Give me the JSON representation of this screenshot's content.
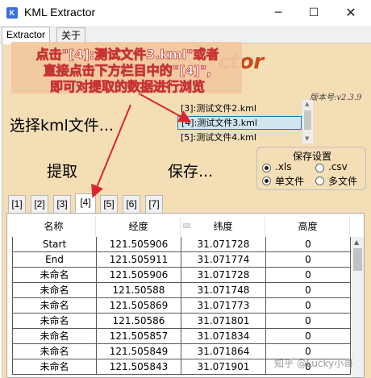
{
  "window": {
    "icon_letter": "K",
    "title": "KML Extractor",
    "min_glyph": "─",
    "max_glyph": "☐",
    "close_glyph": "✕"
  },
  "tabs": [
    {
      "label": "Extractor",
      "active": true
    },
    {
      "label": "关于",
      "active": false
    }
  ],
  "logo_fragment": "ctor",
  "version": "版本号:v2.3.9",
  "annotation": {
    "line1": "点击\"[4]:测试文件3.kml\"或者",
    "line2": "直接点击下方栏目中的\"[4]\",",
    "line3": "即可对提取的数据进行浏览"
  },
  "buttons": {
    "select_kml": "选择kml文件...",
    "extract": "提取",
    "save": "保存..."
  },
  "file_list": {
    "items": [
      {
        "label": "[3]:测试文件2.kml",
        "selected": false
      },
      {
        "label": "[4]:测试文件3.kml",
        "selected": true
      },
      {
        "label": "[5]:测试文件4.kml",
        "selected": false
      }
    ]
  },
  "save_settings": {
    "title": "保存设置",
    "formats": [
      {
        "label": ".xls",
        "checked": true
      },
      {
        "label": ".csv",
        "checked": false
      }
    ],
    "modes": [
      {
        "label": "单文件",
        "checked": true
      },
      {
        "label": "多文件",
        "checked": false
      }
    ]
  },
  "sub_tabs": [
    "[1]",
    "[2]",
    "[3]",
    "[4]",
    "[5]",
    "[6]",
    "[7]"
  ],
  "active_sub_tab": "[4]",
  "table": {
    "columns": [
      "名称",
      "经度",
      "纬度",
      "高度"
    ],
    "rows": [
      [
        "Start",
        "121.505906",
        "31.071728",
        "0"
      ],
      [
        "End",
        "121.505911",
        "31.071774",
        "0"
      ],
      [
        "未命名",
        "121.505906",
        "31.071728",
        "0"
      ],
      [
        "未命名",
        "121.50588",
        "31.071748",
        "0"
      ],
      [
        "未命名",
        "121.505869",
        "31.071773",
        "0"
      ],
      [
        "未命名",
        "121.50586",
        "31.071801",
        "0"
      ],
      [
        "未命名",
        "121.505857",
        "31.071834",
        "0"
      ],
      [
        "未命名",
        "121.505849",
        "31.071864",
        "0"
      ],
      [
        "未命名",
        "121.505843",
        "31.071901",
        "0"
      ]
    ]
  },
  "watermark": "知乎 @Lucky小哥",
  "colors": {
    "panel_bg": "#f4deb6",
    "logo": "#c84a1e",
    "annotation_red": "#d9262b",
    "selected_bg": "#cfe6ee",
    "selected_border": "#1c7fa0"
  }
}
